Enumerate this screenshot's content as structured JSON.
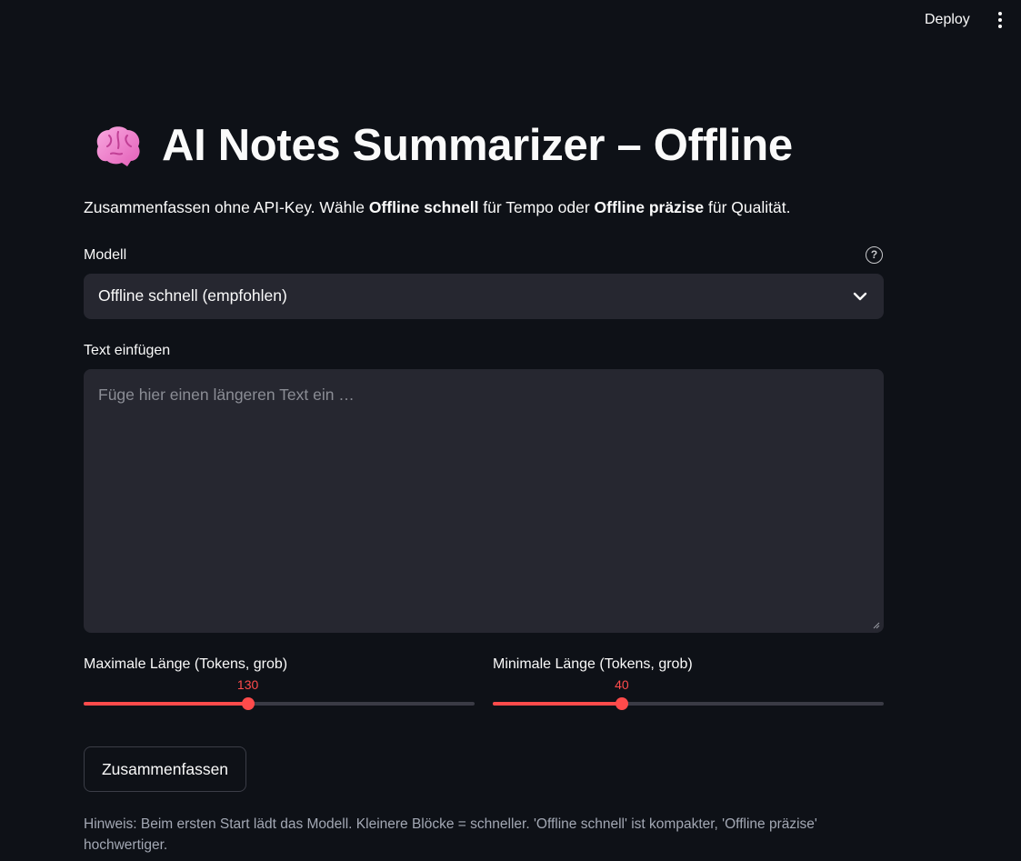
{
  "header": {
    "deploy_label": "Deploy"
  },
  "title": {
    "icon": "brain-emoji-icon",
    "text": "AI Notes Summarizer – Offline"
  },
  "subtitle": {
    "part1": "Zusammenfassen ohne API-Key. Wähle ",
    "bold1": "Offline schnell",
    "part2": " für Tempo oder ",
    "bold2": "Offline präzise",
    "part3": " für Qualität."
  },
  "model": {
    "label": "Modell",
    "help_icon": "?",
    "selected": "Offline schnell (empfohlen)"
  },
  "text_input": {
    "label": "Text einfügen",
    "placeholder": "Füge hier einen längeren Text ein …"
  },
  "sliders": {
    "max": {
      "label": "Maximale Länge (Tokens, grob)",
      "value": "130",
      "fraction": 0.42
    },
    "min": {
      "label": "Minimale Länge (Tokens, grob)",
      "value": "40",
      "fraction": 0.33
    }
  },
  "summarize_button": "Zusammenfassen",
  "hint": "Hinweis: Beim ersten Start lädt das Modell. Kleinere Blöcke = schneller. 'Offline schnell' ist kompakter, 'Offline präzise' hochwertiger.",
  "colors": {
    "accent": "#ff4b4b",
    "background": "#0e1117",
    "input_bg": "#262730"
  }
}
